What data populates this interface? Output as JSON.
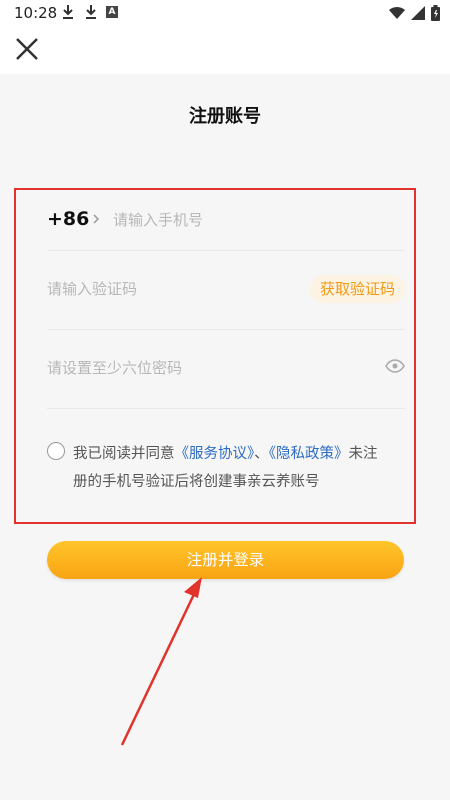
{
  "status_bar": {
    "time": "10:28",
    "icons": [
      "download-icon",
      "download-icon",
      "a-icon",
      "wifi-icon",
      "signal-icon",
      "battery-icon"
    ],
    "a_label": "A"
  },
  "header": {
    "close_icon": "close-icon"
  },
  "page": {
    "title": "注册账号"
  },
  "phone": {
    "country_code": "+86",
    "placeholder": "请输入手机号"
  },
  "verify": {
    "placeholder": "请输入验证码",
    "get_code_label": "获取验证码"
  },
  "password": {
    "placeholder": "请设置至少六位密码",
    "eye_icon": "eye-icon"
  },
  "agreement": {
    "prefix": "我已阅读并同意",
    "service_link": "《服务协议》",
    "separator": "、",
    "privacy_link": "《隐私政策》",
    "suffix": "未注册的手机号验证后将创建事亲云养账号"
  },
  "register_button": {
    "label": "注册并登录"
  },
  "colors": {
    "accent": "#f9a313",
    "link": "#2f6cc4",
    "highlight": "#e2322c"
  }
}
